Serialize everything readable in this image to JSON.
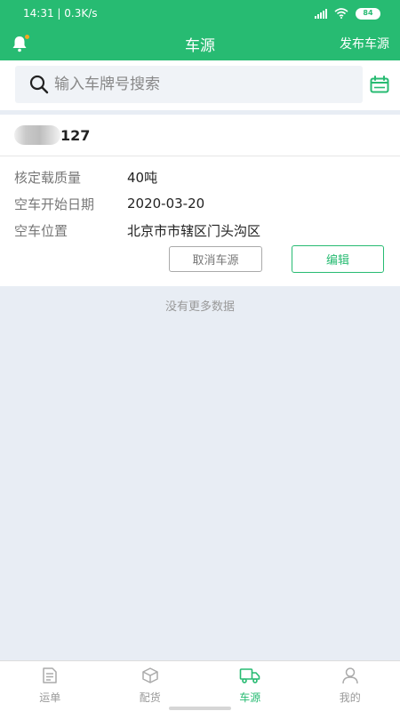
{
  "status_bar": {
    "time_network": "14:31 | 0.3K/s",
    "battery": "84"
  },
  "nav": {
    "title": "车源",
    "publish": "发布车源"
  },
  "search": {
    "placeholder": "输入车牌号搜索"
  },
  "vehicle": {
    "plate_suffix": "127",
    "rows": [
      {
        "label": "核定载质量",
        "value": "40吨"
      },
      {
        "label": "空车开始日期",
        "value": "2020-03-20"
      },
      {
        "label": "空车位置",
        "value": "北京市市辖区门头沟区"
      }
    ],
    "cancel_label": "取消车源",
    "edit_label": "编辑"
  },
  "list_footer": "没有更多数据",
  "tabs": [
    {
      "label": "运单",
      "icon": "waybill-icon",
      "active": false
    },
    {
      "label": "配货",
      "icon": "cargo-box-icon",
      "active": false
    },
    {
      "label": "车源",
      "icon": "truck-icon",
      "active": true
    },
    {
      "label": "我的",
      "icon": "user-icon",
      "active": false
    }
  ],
  "colors": {
    "brand": "#27bb72",
    "background": "#e8edf4",
    "inactive_tab": "#999999"
  }
}
